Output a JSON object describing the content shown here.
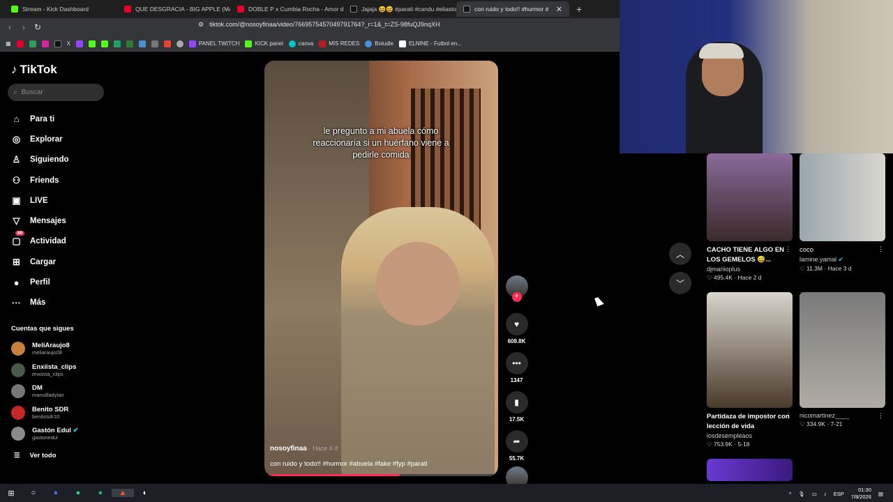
{
  "browser": {
    "tabs": [
      {
        "label": "Stream - Kick Dashboard",
        "icon": "kick"
      },
      {
        "label": "QUE DESGRACIA - BIG APPLE (MAN...",
        "icon": "youtube"
      },
      {
        "label": "DOBLE P x Cumbia Rocha - Amor de",
        "icon": "youtube"
      },
      {
        "label": "Jajaja 😆😆 #parati #candu #eliasto",
        "icon": "tiktok"
      },
      {
        "label": "con ruido y todo!! #hurmor #",
        "icon": "tiktok"
      }
    ],
    "url": "tiktok.com/@nosoyfinaa/video/7669575457049791764?_r=1&_t=ZS-98fuQJ9nqXH",
    "bookmarks": [
      "PANEL TWITCH",
      "KICK panel",
      "canva",
      "MIS REDES",
      "Boiudle",
      "ELNINE - Futbol en..."
    ]
  },
  "sidebar": {
    "logo": "TikTok",
    "search_placeholder": "Buscar",
    "menu": [
      {
        "label": "Para ti",
        "icon": "home-icon"
      },
      {
        "label": "Explorar",
        "icon": "compass-icon"
      },
      {
        "label": "Siguiendo",
        "icon": "following-icon"
      },
      {
        "label": "Friends",
        "icon": "friends-icon"
      },
      {
        "label": "LIVE",
        "icon": "live-icon"
      },
      {
        "label": "Mensajes",
        "icon": "messages-icon"
      },
      {
        "label": "Actividad",
        "icon": "activity-icon",
        "badge": "86"
      },
      {
        "label": "Cargar",
        "icon": "upload-icon"
      },
      {
        "label": "Perfil",
        "icon": "profile-icon"
      },
      {
        "label": "Más",
        "icon": "more-icon"
      }
    ],
    "following_header": "Cuentas que sigues",
    "following": [
      {
        "name": "MeliAraujo8",
        "handle": "meliaraujo08"
      },
      {
        "name": "Enxiista_clips",
        "handle": "enxiista_clips"
      },
      {
        "name": "DM",
        "handle": "mansilladylan"
      },
      {
        "name": "Benito SDR",
        "handle": "benitosdr10"
      },
      {
        "name": "Gastón Edul",
        "handle": "gastonedul"
      }
    ],
    "see_all": "Ver todo"
  },
  "video": {
    "caption": "le pregunto a mi abuela cómo reaccionaría si un huérfano viene a pedirle comida",
    "author": "nosoyfinaa",
    "time": "· Hace 4 d",
    "description": "con ruido y todo!! #hurmor #abuela #fake #fyp #parati",
    "progress": 0.58,
    "likes": "608.8K",
    "comments": "1347",
    "saves": "17.5K",
    "shares": "55.7K"
  },
  "recommendations": [
    {
      "title": "CACHO TIENE ALGO EN LOS GEMELOS 😅...",
      "user": "djmariioplus",
      "likes": "495.4K",
      "time": "Hace 2 d"
    },
    {
      "title": "coco",
      "user": "lamine.yamal",
      "likes": "11.3M",
      "time": "Hace 3 d"
    },
    {
      "title": "Partidaza de impostor con lección de vida",
      "user": "losdesempleaos",
      "likes": "753.9K",
      "time": "5-18"
    },
    {
      "title": "",
      "user": "nicomartinez____",
      "likes": "334.9K",
      "time": "7-21"
    }
  ],
  "taskbar": {
    "lang": "ESP",
    "time": "01:30",
    "date": "7/8/2026"
  }
}
